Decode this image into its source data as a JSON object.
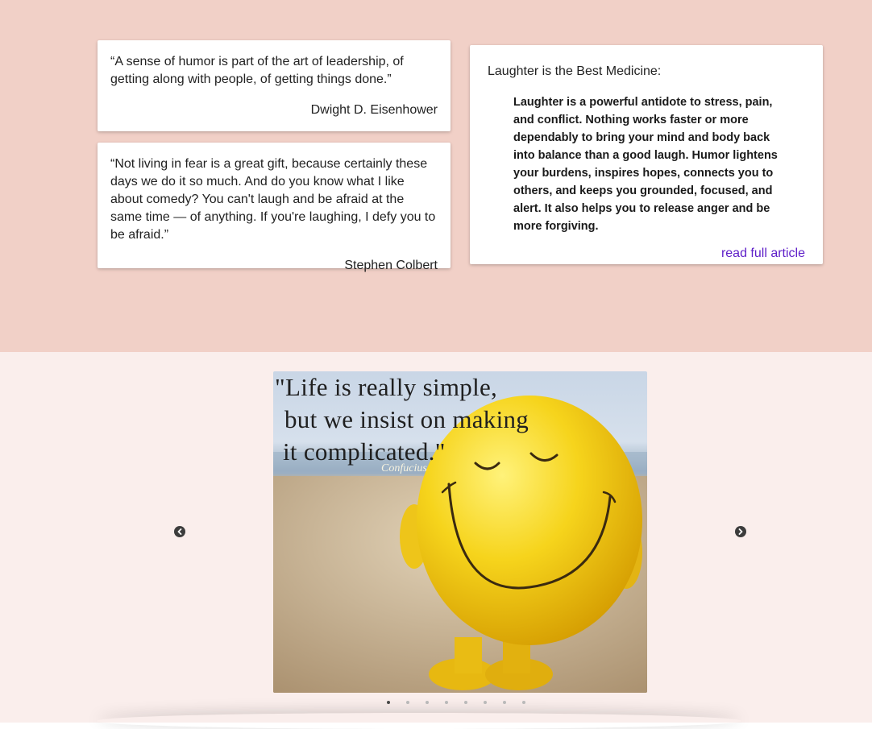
{
  "quotes": [
    {
      "text": "“A sense of humor is part of the art of leadership, of getting along with people, of getting things done.”",
      "author": "Dwight D. Eisenhower"
    },
    {
      "text": "“Not living in fear is a great gift, because certainly these days we do it so much. And do you know what I like about comedy? You can't laugh and be afraid at the same time — of anything. If you're laughing, I defy you to be afraid.”",
      "author": "Stephen Colbert"
    }
  ],
  "article": {
    "title": "Laughter is the Best Medicine:",
    "body": "Laughter is a powerful antidote to stress, pain, and conflict. Nothing works faster or more dependably to bring your mind and body back into balance than a good laugh. Humor lightens your burdens, inspires hopes, connects you to others, and keeps you grounded, focused, and alert. It also helps you to release anger and be more forgiving.",
    "link_label": "read full article"
  },
  "carousel": {
    "caption_lines": [
      "\"Life is really simple,",
      "but we insist on making",
      "it complicated.\""
    ],
    "credit": "Confucius",
    "slide_count": 8,
    "active_index": 0
  },
  "icons": {
    "prev": "chevron-left-icon",
    "next": "chevron-right-icon"
  },
  "colors": {
    "top_background": "#f1d0c7",
    "bottom_background": "#faeeec",
    "link": "#5e1ec8"
  }
}
